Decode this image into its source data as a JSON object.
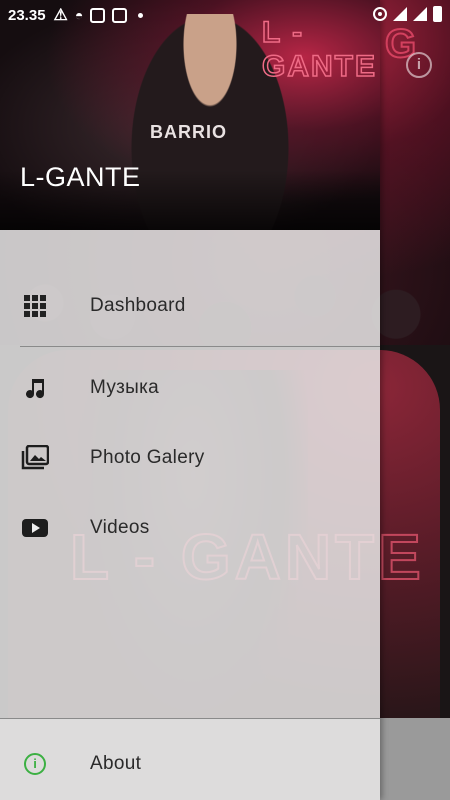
{
  "status_bar": {
    "time": "23.35",
    "icons": [
      "warning-icon",
      "incognito-icon",
      "instagram-icon",
      "image-icon",
      "dot-icon",
      "hotspot-icon",
      "signal-icon",
      "signal-x-icon",
      "battery-icon"
    ]
  },
  "drawer": {
    "header_title": "L-GANTE",
    "items": [
      {
        "label": "Dashboard",
        "icon": "grid-icon"
      },
      {
        "label": "Музыка",
        "icon": "music-note-icon"
      },
      {
        "label": "Photo Galery",
        "icon": "photo-gallery-icon"
      },
      {
        "label": "Videos",
        "icon": "youtube-icon"
      }
    ],
    "footer_item": {
      "label": "About",
      "icon": "info-icon"
    }
  },
  "background": {
    "info_button_icon": "info-icon"
  },
  "colors": {
    "drawer_bg": "#e8e6e6",
    "accent_neon": "#ef6b86",
    "about_icon": "#3cb043",
    "text": "#2a2a2a"
  }
}
